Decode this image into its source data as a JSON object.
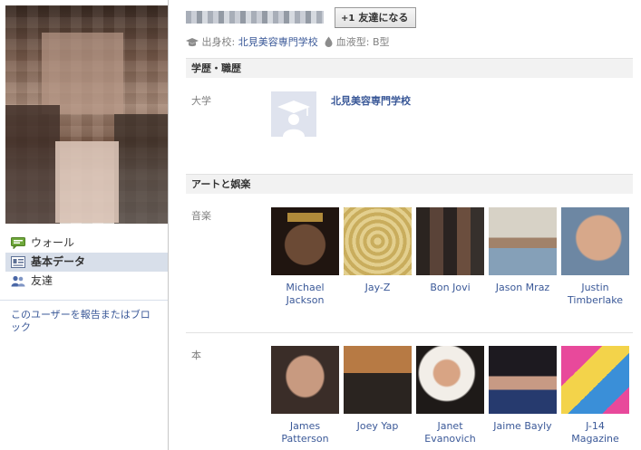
{
  "sidebar": {
    "nav": [
      {
        "label": "ウォール",
        "icon": "wall-icon"
      },
      {
        "label": "基本データ",
        "icon": "info-icon"
      },
      {
        "label": "友達",
        "icon": "friends-icon"
      }
    ],
    "report_link": "このユーザーを報告またはブロック"
  },
  "header": {
    "add_friend_plus": "+1",
    "add_friend_label": "友達になる",
    "info": {
      "school_prefix": "出身校:",
      "school": "北見美容専門学校",
      "blood_prefix": "血液型:",
      "blood": "B型"
    }
  },
  "education": {
    "heading": "学歴・職歴",
    "label": "大学",
    "school": "北見美容専門学校"
  },
  "arts": {
    "heading": "アートと娯楽",
    "music_label": "音楽",
    "music": [
      "Michael Jackson",
      "Jay-Z",
      "Bon Jovi",
      "Jason Mraz",
      "Justin Timberlake"
    ],
    "books_label": "本",
    "books": [
      "James Patterson",
      "Joey Yap",
      "Janet Evanovich",
      "Jaime Bayly",
      "J-14 Magazine"
    ]
  },
  "colors": {
    "link": "#3b5998",
    "nav_active_bg": "#d8dfea",
    "section_head_bg": "#f2f2f2"
  }
}
